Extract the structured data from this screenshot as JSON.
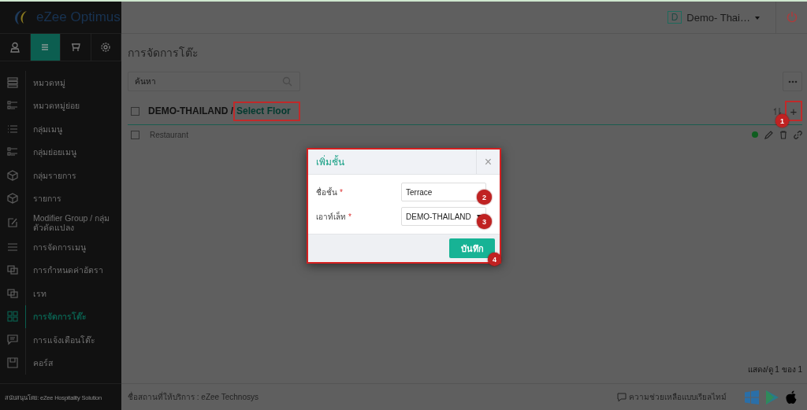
{
  "app": {
    "logo": "eZee Optimus"
  },
  "sidebar_tabs": [
    {
      "kind": "user",
      "selected": false
    },
    {
      "kind": "menu",
      "selected": true
    },
    {
      "kind": "cart",
      "selected": false
    },
    {
      "kind": "settings",
      "selected": false
    }
  ],
  "sidebar": {
    "items": [
      {
        "label": "หมวดหมู่",
        "kind": "cards",
        "selected": false
      },
      {
        "label": "หมวดหมู่ย่อย",
        "kind": "sublist",
        "selected": false
      },
      {
        "label": "กลุ่มเมนู",
        "kind": "list",
        "selected": false
      },
      {
        "label": "กลุ่มย่อยเมนู",
        "kind": "sublist",
        "selected": false
      },
      {
        "label": "กลุ่มรายการ",
        "kind": "box",
        "selected": false
      },
      {
        "label": "รายการ",
        "kind": "box",
        "selected": false
      },
      {
        "label": "Modifier Group / กลุ่มตัวดัดแปลง",
        "kind": "edit",
        "selected": false
      },
      {
        "label": "การจัดการเมนู",
        "kind": "lines",
        "selected": false
      },
      {
        "label": "การกำหนดค่าอัตรา",
        "kind": "copy",
        "selected": false
      },
      {
        "label": "เรท",
        "kind": "copy",
        "selected": false
      },
      {
        "label": "การจัดการโต๊ะ",
        "kind": "grid",
        "selected": true
      },
      {
        "label": "การแจ้งเตือนโต๊ะ",
        "kind": "chat",
        "selected": false
      },
      {
        "label": "คอร์ส",
        "kind": "save",
        "selected": false
      }
    ],
    "footer": "สนับสนุนโดย: eZee Hospitality Solution"
  },
  "header": {
    "property_initial": "D",
    "property": "Demo- Thai…"
  },
  "page": {
    "title": "การจัดการโต๊ะ",
    "search": {
      "placeholder": "ค้นหา"
    },
    "breadcrumb": {
      "root": "DEMO-THAILAND /",
      "current": "Select Floor",
      "checked": false,
      "add": "+"
    },
    "rows": [
      {
        "name": "Restaurant",
        "checked": false,
        "active": true
      }
    ],
    "pagination": "แสดง/ดู 1 ของ 1"
  },
  "footer": {
    "provider": "ชื่อสถานที่ให้บริการ : eZee Technosys",
    "help": "ความช่วยเหลือแบบเรียลไทม์"
  },
  "dialog": {
    "title": "เพิ่มชั้น",
    "close": "×",
    "fields": [
      {
        "label": "ชื่อชั้น",
        "required": true,
        "kind": "text",
        "value": "Terrace"
      },
      {
        "label": "เอาท์เล็ท",
        "required": true,
        "kind": "select",
        "value": "DEMO-THAILAND"
      }
    ],
    "required_mark": "*",
    "save": "บันทึก"
  },
  "markers": [
    "1",
    "2",
    "3",
    "4"
  ]
}
